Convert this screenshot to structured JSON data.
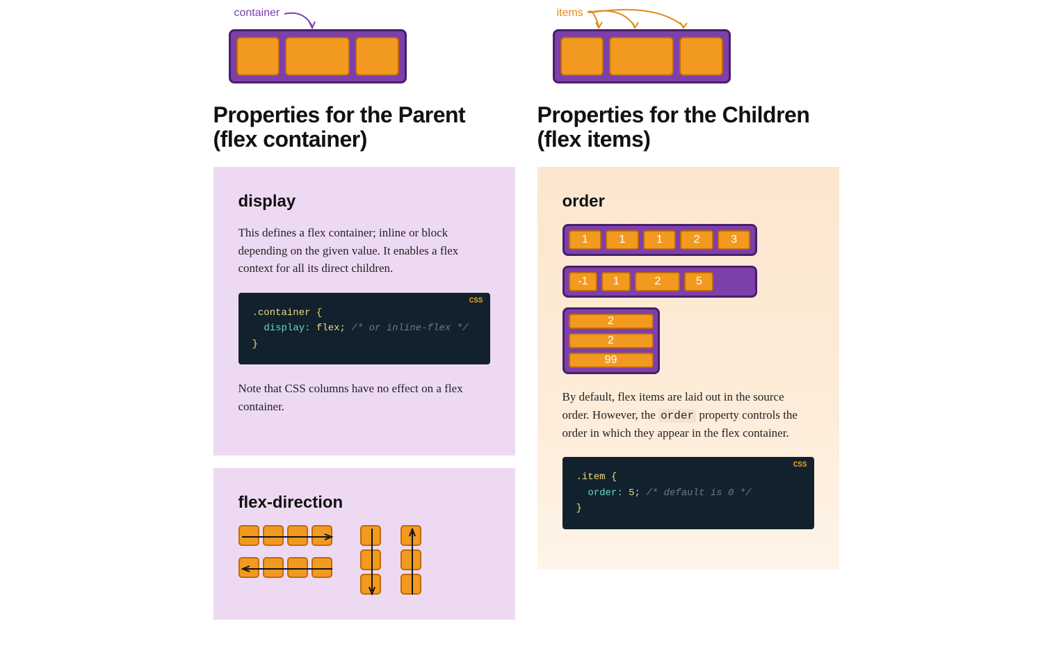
{
  "left": {
    "illus_label": "container",
    "title_line1": "Properties for the Parent",
    "title_line2": "(flex container)",
    "display": {
      "heading": "display",
      "desc": "This defines a flex container; inline or block depending on the given value. It enables a flex context for all its direct children.",
      "code": {
        "lang": "CSS",
        "selector": ".container {",
        "prop": "display:",
        "val": "flex;",
        "comment": "/* or inline-flex */",
        "close": "}"
      },
      "note": "Note that CSS columns have no effect on a flex container."
    },
    "flex_direction": {
      "heading": "flex-direction"
    }
  },
  "right": {
    "illus_label": "items",
    "title_line1": "Properties for the Children",
    "title_line2": "(flex items)",
    "order": {
      "heading": "order",
      "row1": [
        "1",
        "1",
        "1",
        "2",
        "3"
      ],
      "row2": [
        "-1",
        "1",
        "2",
        "5"
      ],
      "col": [
        "2",
        "2",
        "99"
      ],
      "desc_pre": "By default, flex items are laid out in the source order. However, the ",
      "desc_code": "order",
      "desc_post": " property controls the order in which they appear in the flex container.",
      "code": {
        "lang": "CSS",
        "selector": ".item {",
        "prop": "order:",
        "val": "5;",
        "comment": "/* default is 0 */",
        "close": "}"
      }
    }
  }
}
